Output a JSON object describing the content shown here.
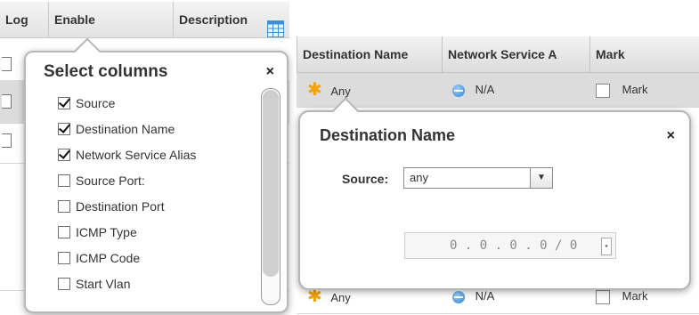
{
  "left_table": {
    "headers": [
      "Log",
      "Enable",
      "Description"
    ],
    "column_chooser_icon": "columns-grid-icon"
  },
  "columns_popup": {
    "title": "Select columns",
    "close_symbol": "×",
    "options": [
      {
        "label": "Source",
        "checked": true
      },
      {
        "label": "Destination Name",
        "checked": true
      },
      {
        "label": "Network Service Alias",
        "checked": true
      },
      {
        "label": "Source Port:",
        "checked": false
      },
      {
        "label": "Destination Port",
        "checked": false
      },
      {
        "label": "ICMP Type",
        "checked": false
      },
      {
        "label": "ICMP Code",
        "checked": false
      },
      {
        "label": "Start Vlan",
        "checked": false
      }
    ]
  },
  "right_table": {
    "headers": [
      "Destination Name",
      "Network Service A",
      "Mark"
    ],
    "rows": [
      {
        "destination": "Any",
        "network_service": "N/A",
        "mark": "Mark"
      },
      {
        "destination": "Any",
        "network_service": "N/A",
        "mark": "Mark"
      }
    ]
  },
  "destination_popup": {
    "title": "Destination Name",
    "close_symbol": "×",
    "source_label": "Source:",
    "source_value": "any",
    "ip_value": "0 . 0 . 0 . 0 / 0"
  },
  "colors": {
    "accent_star": "#f1a20d",
    "globe": "#2f7fd0",
    "row_highlight": "#dcdcdc"
  }
}
